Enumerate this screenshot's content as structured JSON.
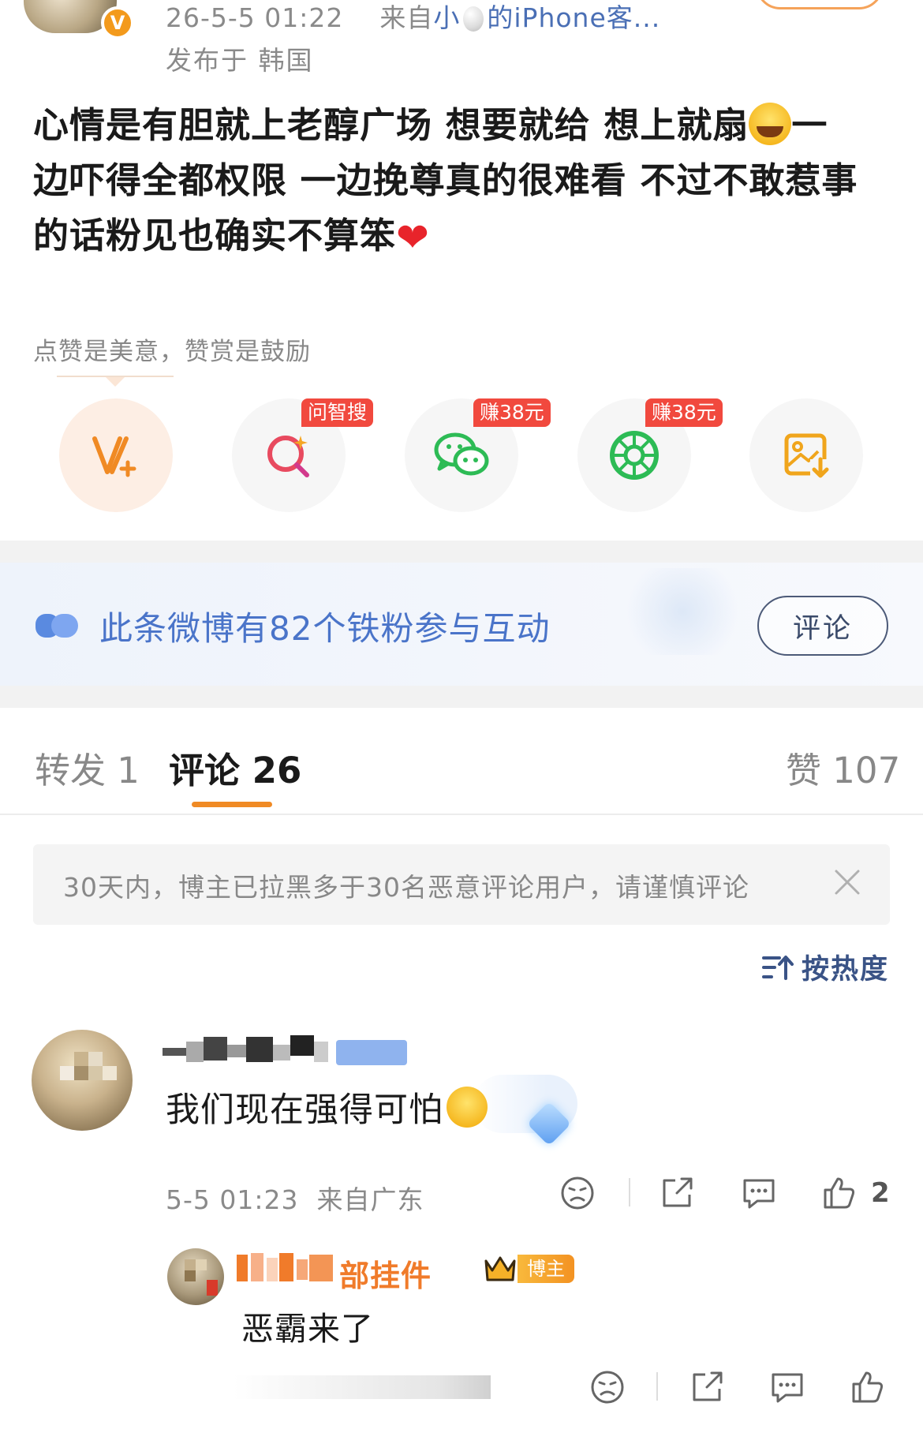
{
  "header": {
    "date": "26-5-5 01:22",
    "source_prefix": "来自",
    "source_name_pre": "小",
    "source_name_post": "的iPhone客...",
    "publish_location": "发布于 韩国",
    "verified_badge": "V"
  },
  "post": {
    "line1": "心情是有胆就上老醇广场 想要就给 想上就扇",
    "line1_tail": "一",
    "line2": "边吓得全都权限 一边挽尊真的很难看 不过不敢惹事",
    "line3": "的话粉见也确实不算笨",
    "heart": "❤"
  },
  "reward": {
    "hint": "点赞是美意，赞赏是鼓励",
    "actions": [
      {
        "icon": "v-plus-icon",
        "tag": ""
      },
      {
        "icon": "ai-search-icon",
        "tag": "问智搜"
      },
      {
        "icon": "wechat-icon",
        "tag": "赚38元"
      },
      {
        "icon": "moments-icon",
        "tag": "赚38元"
      },
      {
        "icon": "save-image-icon",
        "tag": ""
      }
    ]
  },
  "fans": {
    "text": "此条微博有82个铁粉参与互动",
    "button": "评论"
  },
  "tabs": {
    "repost": "转发 1",
    "comment": "评论 26",
    "like": "赞 107"
  },
  "notice": {
    "text": "30天内，博主已拉黑多于30名恶意评论用户，请谨慎评论"
  },
  "sort": {
    "label": "按热度"
  },
  "comments": [
    {
      "text": "我们现在强得可怕",
      "time": "5-5 01:23",
      "location": "来自广东",
      "likes": "2"
    }
  ],
  "reply": {
    "name": "部挂件",
    "badge": "博主",
    "text": "恶霸来了"
  },
  "colors": {
    "accent": "#f08a24",
    "link": "#4a74c9",
    "tag_red": "#f1493e",
    "reply_name": "#f07b2a"
  }
}
